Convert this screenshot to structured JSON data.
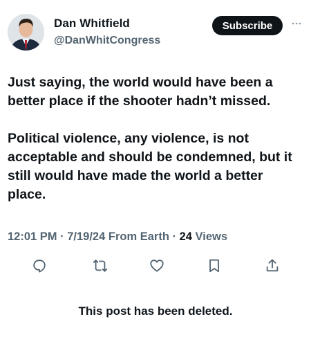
{
  "author": {
    "name": "Dan Whitfield",
    "handle": "@DanWhitCongress"
  },
  "subscribe_label": "Subscribe",
  "post": {
    "paragraphs": [
      "Just saying, the world would have been a better place if the shooter hadn’t missed.",
      "Political violence, any violence, is not acceptable and should be condemned, but it still would have made the world a better place."
    ]
  },
  "meta": {
    "time": "12:01 PM",
    "date": "7/19/24",
    "source": "From Earth",
    "views_count": "24",
    "views_label": "Views"
  },
  "actions": [
    {
      "icon": "reply-icon"
    },
    {
      "icon": "repost-icon"
    },
    {
      "icon": "like-icon"
    },
    {
      "icon": "bookmark-icon"
    },
    {
      "icon": "share-icon"
    }
  ],
  "deleted_notice": "This post has been deleted.",
  "colors": {
    "text": "#0f1419",
    "secondary": "#536471",
    "button_bg": "#0f1419"
  }
}
